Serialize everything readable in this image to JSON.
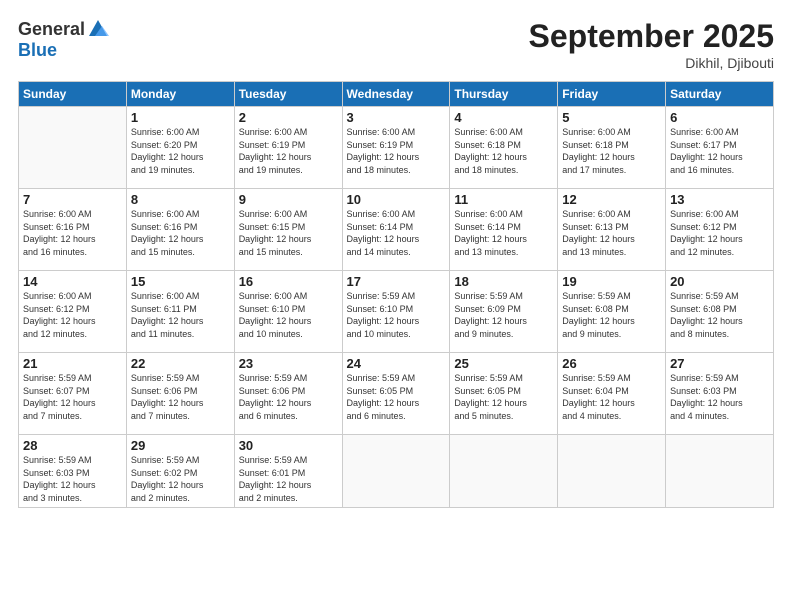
{
  "logo": {
    "general": "General",
    "blue": "Blue"
  },
  "title": "September 2025",
  "location": "Dikhil, Djibouti",
  "days_header": [
    "Sunday",
    "Monday",
    "Tuesday",
    "Wednesday",
    "Thursday",
    "Friday",
    "Saturday"
  ],
  "weeks": [
    [
      {
        "num": "",
        "sunrise": "",
        "sunset": "",
        "daylight": ""
      },
      {
        "num": "1",
        "sunrise": "Sunrise: 6:00 AM",
        "sunset": "Sunset: 6:20 PM",
        "daylight": "Daylight: 12 hours and 19 minutes."
      },
      {
        "num": "2",
        "sunrise": "Sunrise: 6:00 AM",
        "sunset": "Sunset: 6:19 PM",
        "daylight": "Daylight: 12 hours and 19 minutes."
      },
      {
        "num": "3",
        "sunrise": "Sunrise: 6:00 AM",
        "sunset": "Sunset: 6:19 PM",
        "daylight": "Daylight: 12 hours and 18 minutes."
      },
      {
        "num": "4",
        "sunrise": "Sunrise: 6:00 AM",
        "sunset": "Sunset: 6:18 PM",
        "daylight": "Daylight: 12 hours and 18 minutes."
      },
      {
        "num": "5",
        "sunrise": "Sunrise: 6:00 AM",
        "sunset": "Sunset: 6:18 PM",
        "daylight": "Daylight: 12 hours and 17 minutes."
      },
      {
        "num": "6",
        "sunrise": "Sunrise: 6:00 AM",
        "sunset": "Sunset: 6:17 PM",
        "daylight": "Daylight: 12 hours and 16 minutes."
      }
    ],
    [
      {
        "num": "7",
        "sunrise": "Sunrise: 6:00 AM",
        "sunset": "Sunset: 6:16 PM",
        "daylight": "Daylight: 12 hours and 16 minutes."
      },
      {
        "num": "8",
        "sunrise": "Sunrise: 6:00 AM",
        "sunset": "Sunset: 6:16 PM",
        "daylight": "Daylight: 12 hours and 15 minutes."
      },
      {
        "num": "9",
        "sunrise": "Sunrise: 6:00 AM",
        "sunset": "Sunset: 6:15 PM",
        "daylight": "Daylight: 12 hours and 15 minutes."
      },
      {
        "num": "10",
        "sunrise": "Sunrise: 6:00 AM",
        "sunset": "Sunset: 6:14 PM",
        "daylight": "Daylight: 12 hours and 14 minutes."
      },
      {
        "num": "11",
        "sunrise": "Sunrise: 6:00 AM",
        "sunset": "Sunset: 6:14 PM",
        "daylight": "Daylight: 12 hours and 13 minutes."
      },
      {
        "num": "12",
        "sunrise": "Sunrise: 6:00 AM",
        "sunset": "Sunset: 6:13 PM",
        "daylight": "Daylight: 12 hours and 13 minutes."
      },
      {
        "num": "13",
        "sunrise": "Sunrise: 6:00 AM",
        "sunset": "Sunset: 6:12 PM",
        "daylight": "Daylight: 12 hours and 12 minutes."
      }
    ],
    [
      {
        "num": "14",
        "sunrise": "Sunrise: 6:00 AM",
        "sunset": "Sunset: 6:12 PM",
        "daylight": "Daylight: 12 hours and 12 minutes."
      },
      {
        "num": "15",
        "sunrise": "Sunrise: 6:00 AM",
        "sunset": "Sunset: 6:11 PM",
        "daylight": "Daylight: 12 hours and 11 minutes."
      },
      {
        "num": "16",
        "sunrise": "Sunrise: 6:00 AM",
        "sunset": "Sunset: 6:10 PM",
        "daylight": "Daylight: 12 hours and 10 minutes."
      },
      {
        "num": "17",
        "sunrise": "Sunrise: 5:59 AM",
        "sunset": "Sunset: 6:10 PM",
        "daylight": "Daylight: 12 hours and 10 minutes."
      },
      {
        "num": "18",
        "sunrise": "Sunrise: 5:59 AM",
        "sunset": "Sunset: 6:09 PM",
        "daylight": "Daylight: 12 hours and 9 minutes."
      },
      {
        "num": "19",
        "sunrise": "Sunrise: 5:59 AM",
        "sunset": "Sunset: 6:08 PM",
        "daylight": "Daylight: 12 hours and 9 minutes."
      },
      {
        "num": "20",
        "sunrise": "Sunrise: 5:59 AM",
        "sunset": "Sunset: 6:08 PM",
        "daylight": "Daylight: 12 hours and 8 minutes."
      }
    ],
    [
      {
        "num": "21",
        "sunrise": "Sunrise: 5:59 AM",
        "sunset": "Sunset: 6:07 PM",
        "daylight": "Daylight: 12 hours and 7 minutes."
      },
      {
        "num": "22",
        "sunrise": "Sunrise: 5:59 AM",
        "sunset": "Sunset: 6:06 PM",
        "daylight": "Daylight: 12 hours and 7 minutes."
      },
      {
        "num": "23",
        "sunrise": "Sunrise: 5:59 AM",
        "sunset": "Sunset: 6:06 PM",
        "daylight": "Daylight: 12 hours and 6 minutes."
      },
      {
        "num": "24",
        "sunrise": "Sunrise: 5:59 AM",
        "sunset": "Sunset: 6:05 PM",
        "daylight": "Daylight: 12 hours and 6 minutes."
      },
      {
        "num": "25",
        "sunrise": "Sunrise: 5:59 AM",
        "sunset": "Sunset: 6:05 PM",
        "daylight": "Daylight: 12 hours and 5 minutes."
      },
      {
        "num": "26",
        "sunrise": "Sunrise: 5:59 AM",
        "sunset": "Sunset: 6:04 PM",
        "daylight": "Daylight: 12 hours and 4 minutes."
      },
      {
        "num": "27",
        "sunrise": "Sunrise: 5:59 AM",
        "sunset": "Sunset: 6:03 PM",
        "daylight": "Daylight: 12 hours and 4 minutes."
      }
    ],
    [
      {
        "num": "28",
        "sunrise": "Sunrise: 5:59 AM",
        "sunset": "Sunset: 6:03 PM",
        "daylight": "Daylight: 12 hours and 3 minutes."
      },
      {
        "num": "29",
        "sunrise": "Sunrise: 5:59 AM",
        "sunset": "Sunset: 6:02 PM",
        "daylight": "Daylight: 12 hours and 2 minutes."
      },
      {
        "num": "30",
        "sunrise": "Sunrise: 5:59 AM",
        "sunset": "Sunset: 6:01 PM",
        "daylight": "Daylight: 12 hours and 2 minutes."
      },
      {
        "num": "",
        "sunrise": "",
        "sunset": "",
        "daylight": ""
      },
      {
        "num": "",
        "sunrise": "",
        "sunset": "",
        "daylight": ""
      },
      {
        "num": "",
        "sunrise": "",
        "sunset": "",
        "daylight": ""
      },
      {
        "num": "",
        "sunrise": "",
        "sunset": "",
        "daylight": ""
      }
    ]
  ]
}
